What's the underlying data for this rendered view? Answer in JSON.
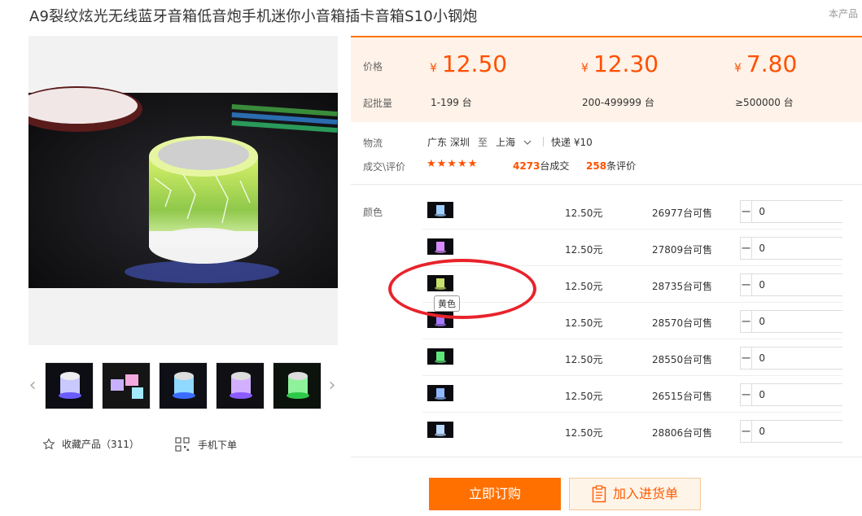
{
  "product": {
    "title": "A9裂纹炫光无线蓝牙音箱低音炮手机迷你小音箱插卡音箱S10小钢炮",
    "corner_note": "本产品"
  },
  "gallery": {
    "main_image_icon": "speaker-photo",
    "prev_label": "‹",
    "next_label": "›",
    "thumbnails": [
      "thumb-1",
      "thumb-2",
      "thumb-3",
      "thumb-4",
      "thumb-5"
    ]
  },
  "actions": {
    "favorite_label": "收藏产品（311）",
    "mobile_label": "手机下单",
    "order_label": "立即订购",
    "cart_label": "加入进货单"
  },
  "price_band": {
    "price_label": "价格",
    "moq_label": "起批量",
    "currency": "¥",
    "tiers": [
      {
        "price": "12.50",
        "range": "1-199 台"
      },
      {
        "price": "12.30",
        "range": "200-499999 台"
      },
      {
        "price": "7.80",
        "range": "≥500000 台"
      }
    ]
  },
  "logistics": {
    "label": "物流",
    "from": "广东 深圳",
    "to_word": "至",
    "to": "上海",
    "shipping": "快递 ¥10"
  },
  "deals": {
    "label": "成交\\评价",
    "rating": 4.5,
    "stars": "★★★★★",
    "deals_count": "4273",
    "deals_suffix": "台成交",
    "reviews_count": "258",
    "reviews_suffix": "条评价"
  },
  "sku": {
    "label": "颜色",
    "tooltip": "黄色",
    "rows": [
      {
        "price": "12.50元",
        "stock": "26977台可售",
        "qty": "0",
        "color": "#9fd0ff"
      },
      {
        "price": "12.50元",
        "stock": "27809台可售",
        "qty": "0",
        "color": "#d98cff"
      },
      {
        "price": "12.50元",
        "stock": "28735台可售",
        "qty": "0",
        "color": "#c8e06a"
      },
      {
        "price": "12.50元",
        "stock": "28570台可售",
        "qty": "0",
        "color": "#a77bff"
      },
      {
        "price": "12.50元",
        "stock": "28550台可售",
        "qty": "0",
        "color": "#5fe87a"
      },
      {
        "price": "12.50元",
        "stock": "26515台可售",
        "qty": "0",
        "color": "#8fb8ff"
      },
      {
        "price": "12.50元",
        "stock": "28806台可售",
        "qty": "0",
        "color": "#b9d9ff"
      }
    ],
    "minus": "−",
    "plus": "+"
  },
  "colors": {
    "accent": "#ff7000",
    "price": "#ff5000",
    "annotation_circle": "#e8232b"
  }
}
